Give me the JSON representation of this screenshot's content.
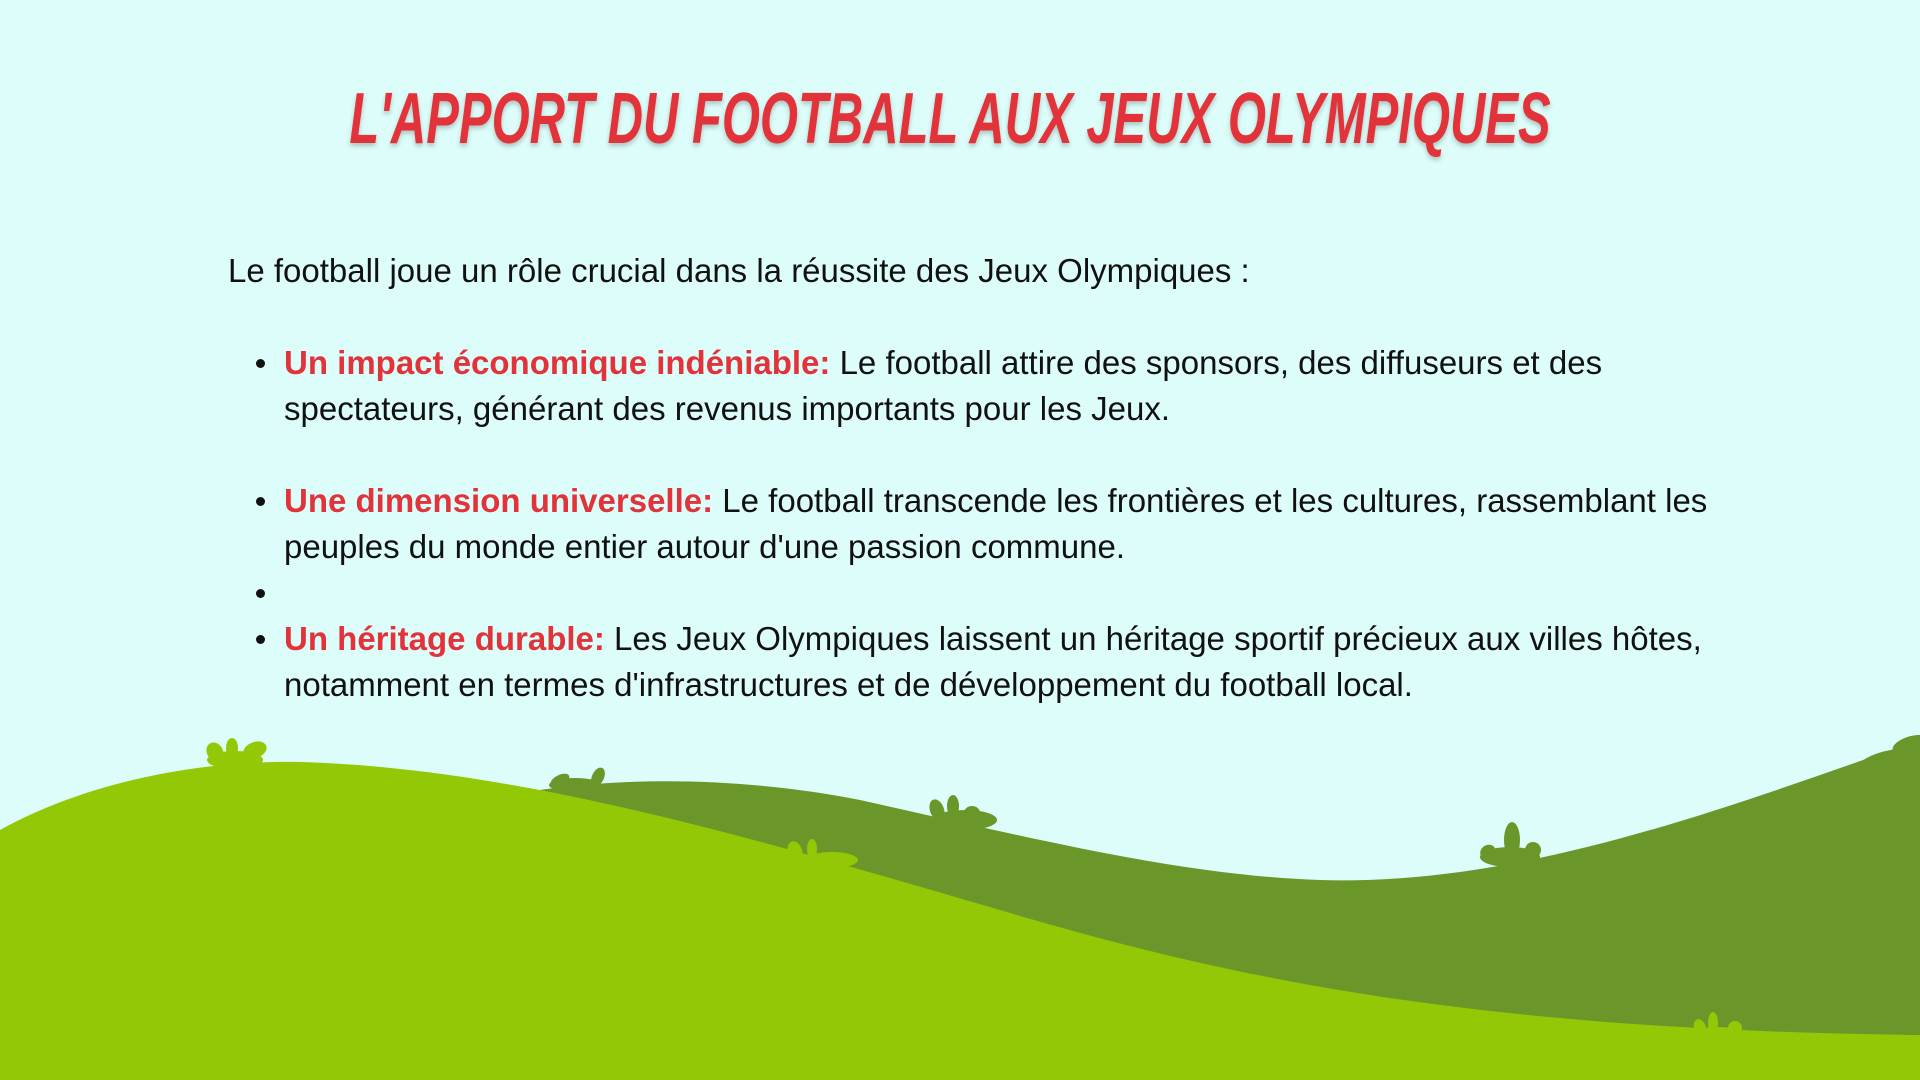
{
  "slide": {
    "title": "L'APPORT DU FOOTBALL AUX JEUX OLYMPIQUES",
    "intro": "Le football joue un rôle crucial dans la réussite des Jeux Olympiques :",
    "bullets": [
      {
        "label": "Un impact économique indéniable:",
        "text": " Le football attire des sponsors, des diffuseurs et des spectateurs, générant des revenus importants pour les Jeux."
      },
      {
        "label": "Une dimension universelle:",
        "text": " Le football transcende les frontières et les cultures, rassemblant les peuples du monde entier autour d'une passion commune."
      },
      {
        "label": "",
        "text": ""
      },
      {
        "label": "Un héritage durable:",
        "text": " Les Jeux Olympiques laissent un héritage sportif précieux aux villes hôtes, notamment en termes d'infrastructures et de développement du football local."
      }
    ]
  },
  "colors": {
    "background": "#dcfdf9",
    "title": "#e2323a",
    "label": "#e2323a",
    "body_text": "#111111",
    "hill_light": "#93c806",
    "hill_dark": "#6b972a"
  },
  "icons": {
    "decor": [
      "grass-tuft-icon"
    ]
  }
}
